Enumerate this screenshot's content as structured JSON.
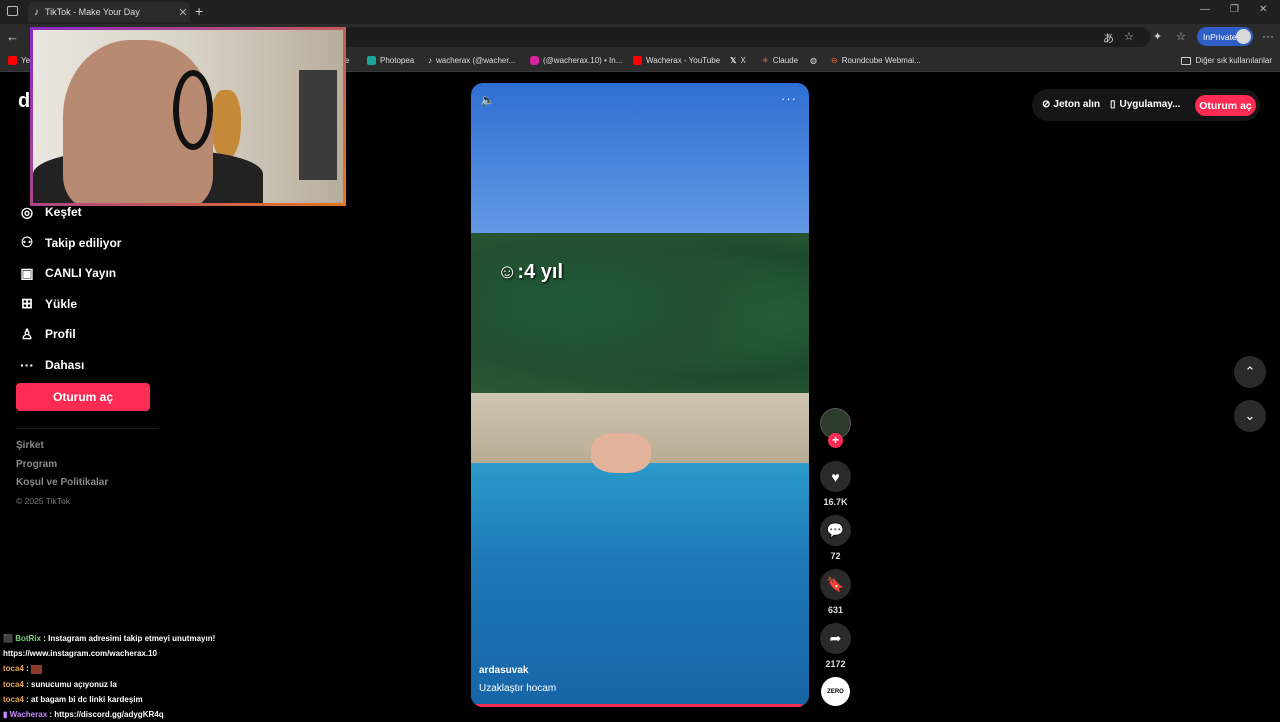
{
  "browser": {
    "tab_title": "TikTok - Make Your Day",
    "inprivate_label": "InPrivate",
    "bookmarks": [
      {
        "label": "Ye",
        "color": "#ff0000"
      },
      {
        "label": "ube",
        "color": "#ff0000"
      },
      {
        "label": "Photopea",
        "color": "#18a497"
      },
      {
        "label": "wacherax (@wacher...",
        "color": "#ffffff"
      },
      {
        "label": "(@wacherax.10) • In...",
        "color": "#d6249f"
      },
      {
        "label": "Wacherax - YouTube",
        "color": "#ff0000"
      },
      {
        "label": "X",
        "color": "#ffffff"
      },
      {
        "label": "Claude",
        "color": "#d97757"
      },
      {
        "label": "",
        "color": "#bbbbbb"
      },
      {
        "label": "Roundcube Webmai...",
        "color": "#e8632b"
      }
    ],
    "other_bookmarks_label": "Diğer sık kullanılanlar"
  },
  "sidebar": {
    "logo": "d",
    "items": [
      {
        "label": "Keşfet",
        "icon": "compass-icon",
        "glyph": "◎"
      },
      {
        "label": "Takip ediliyor",
        "icon": "following-icon",
        "glyph": "⚇"
      },
      {
        "label": "CANLI Yayın",
        "icon": "live-icon",
        "glyph": "▣"
      },
      {
        "label": "Yükle",
        "icon": "upload-icon",
        "glyph": "⊞"
      },
      {
        "label": "Profil",
        "icon": "profile-icon",
        "glyph": "♙"
      },
      {
        "label": "Dahası",
        "icon": "more-icon",
        "glyph": "···"
      }
    ],
    "login_label": "Oturum aç",
    "footer": [
      "Şirket",
      "Program",
      "Koşul ve Politikalar"
    ],
    "copyright": "© 2025 TikTok"
  },
  "video": {
    "caption_overlay": ":4 yıl",
    "author": "ardasuvak",
    "description": "Uzaklaştır hocam",
    "progress": 0.98
  },
  "actions": {
    "likes": "16.7K",
    "comments": "72",
    "saves": "631",
    "shares": "2172",
    "music_label": "ZERO"
  },
  "header": {
    "coins_label": "Jeton alın",
    "app_label": "Uygulamay...",
    "login_label": "Oturum aç"
  },
  "chat": [
    {
      "user": "BotRix",
      "sep": " : ",
      "msg": "Instagram adresimi takip etmeyi unutmayın!",
      "cls": "u1"
    },
    {
      "user": "",
      "sep": "",
      "msg": "https://www.instagram.com/wacherax.10",
      "cls": ""
    },
    {
      "user": "toca4",
      "sep": " : ",
      "msg": "",
      "cls": "u2",
      "emote": true
    },
    {
      "user": "toca4",
      "sep": " : ",
      "msg": "sunucumu açıyonuz la",
      "cls": "u2"
    },
    {
      "user": "toca4",
      "sep": " : ",
      "msg": "at bagam bi dc linki kardeşim",
      "cls": "u2"
    },
    {
      "user": "Wacherax",
      "sep": " : ",
      "msg": "https://discord.gg/adygKR4q",
      "cls": "u3"
    }
  ]
}
